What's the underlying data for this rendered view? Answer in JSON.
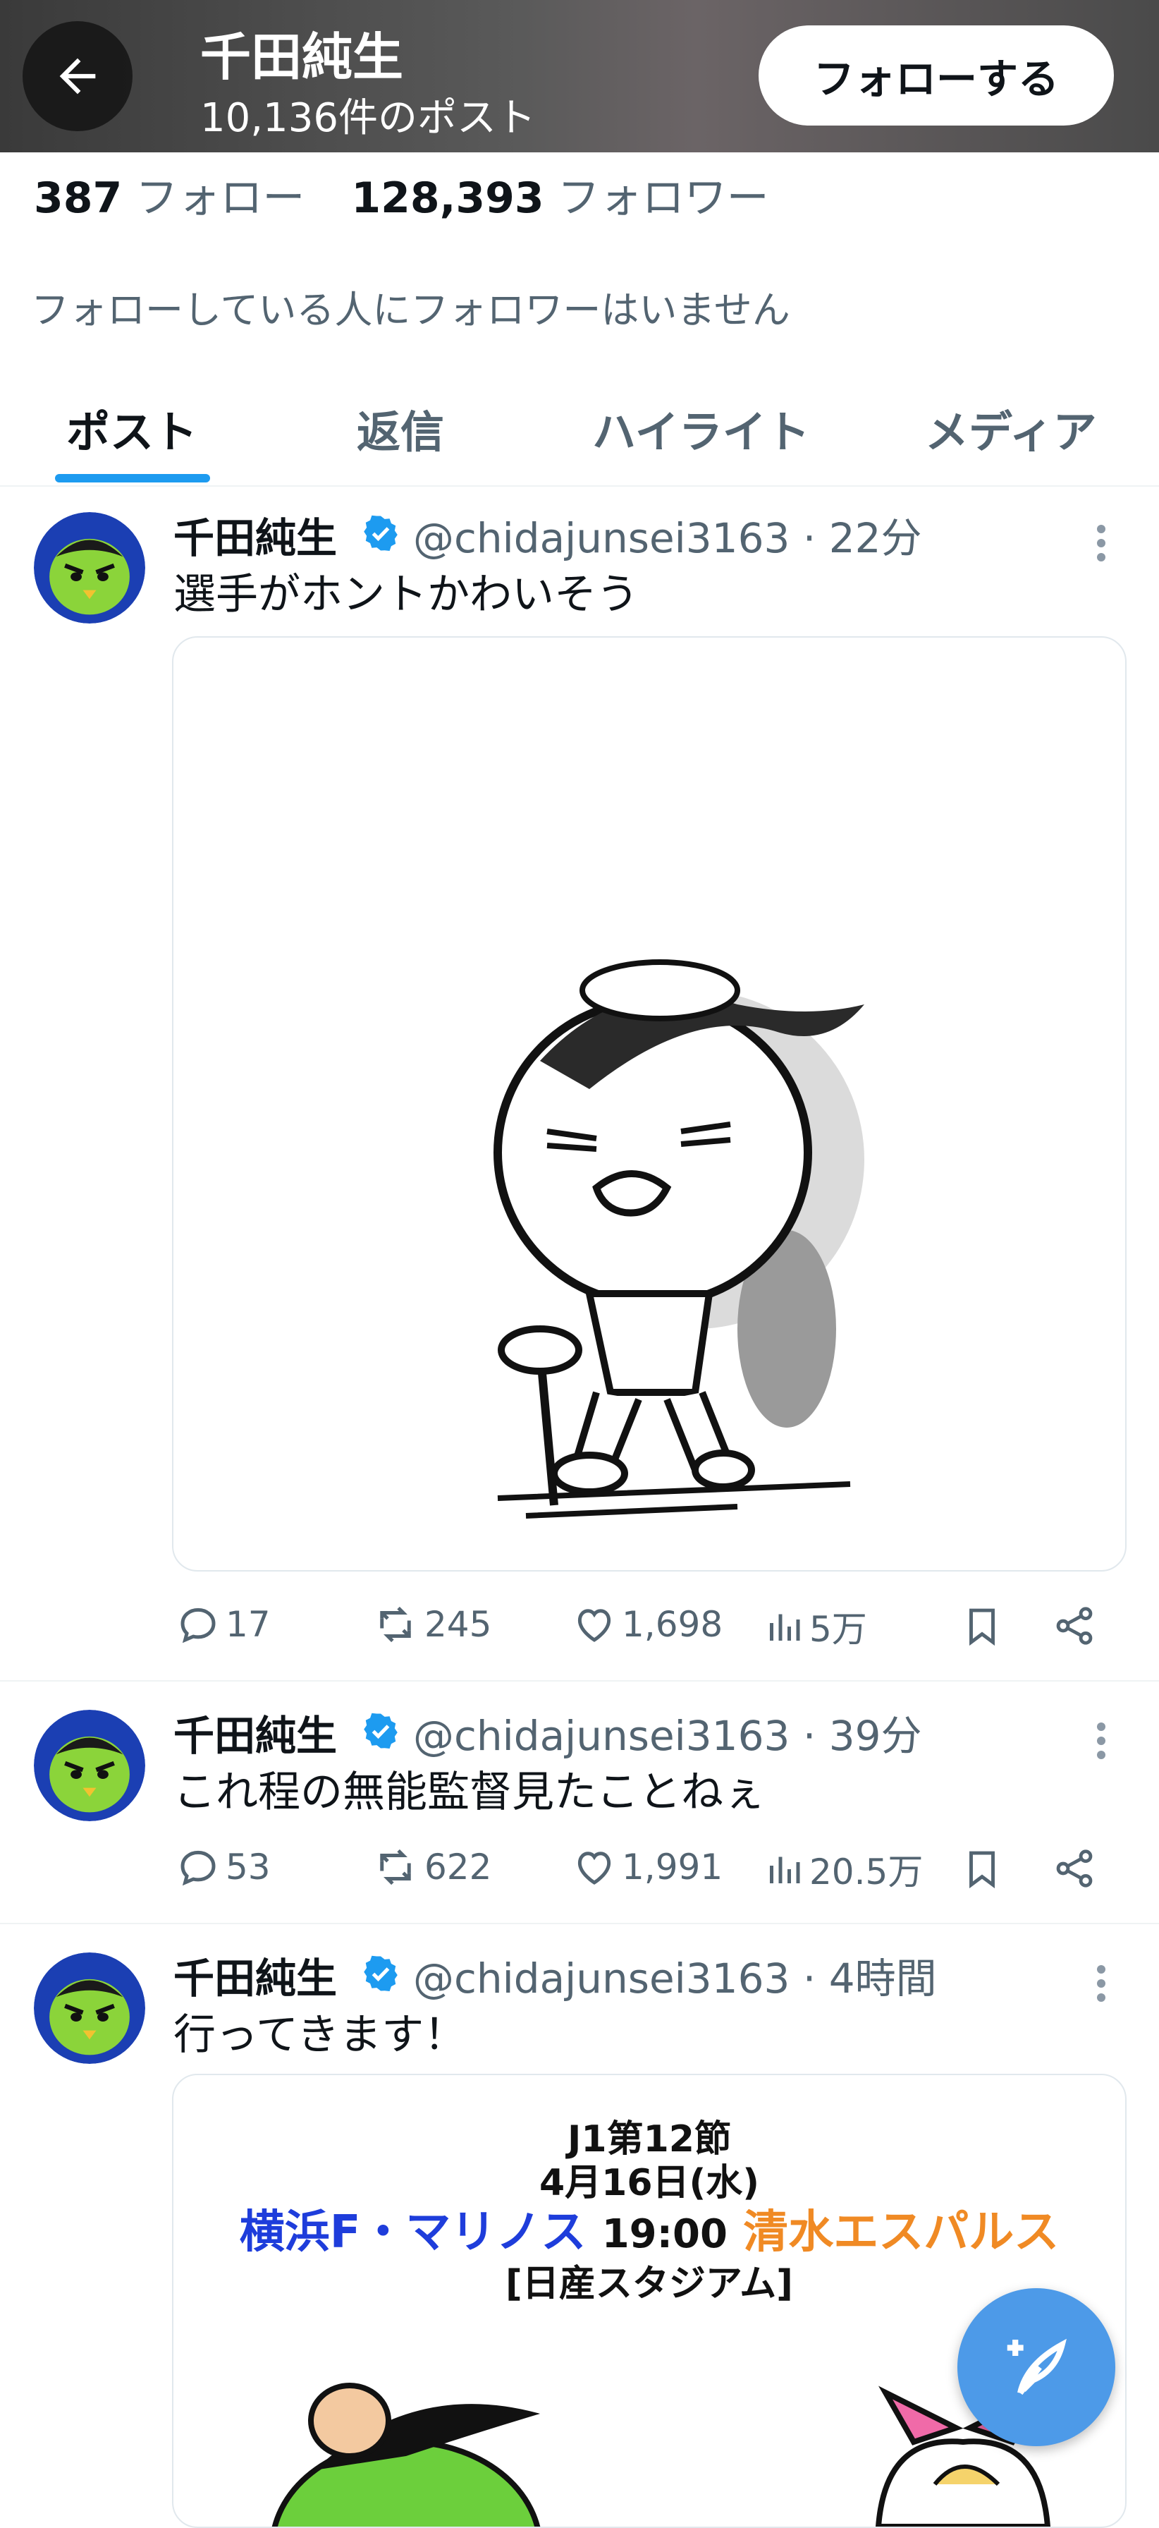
{
  "header": {
    "name": "千田純生",
    "post_count": "10,136件のポスト",
    "follow_button": "フォローする"
  },
  "stats": {
    "following_count": "387",
    "following_label": "フォロー",
    "followers_count": "128,393",
    "followers_label": "フォロワー",
    "no_mutual_note": "フォローしている人にフォロワーはいません"
  },
  "tabs": [
    "ポスト",
    "返信",
    "ハイライト",
    "メディア"
  ],
  "posts": [
    {
      "name": "千田純生",
      "handle": "@chidajunsei3163",
      "time": "· 22分",
      "text": "選手がホントかわいそう",
      "replies": "17",
      "reposts": "245",
      "likes": "1,698",
      "views": "5万"
    },
    {
      "name": "千田純生",
      "handle": "@chidajunsei3163",
      "time": "· 39分",
      "text": "これ程の無能監督見たことねぇ",
      "replies": "53",
      "reposts": "622",
      "likes": "1,991",
      "views": "20.5万"
    },
    {
      "name": "千田純生",
      "handle": "@chidajunsei3163",
      "time": "· 4時間",
      "text": "行ってきます！",
      "poster": {
        "line1": "J1第12節",
        "line2": "4月16日(水)",
        "home": "横浜F・マリノス",
        "kickoff": "19:00",
        "away": "清水エスパルス",
        "venue": "[日産スタジアム]"
      }
    }
  ],
  "icons": [
    "back-arrow-icon",
    "verified-icon",
    "more-icon",
    "reply-icon",
    "repost-icon",
    "like-icon",
    "views-icon",
    "bookmark-icon",
    "share-icon",
    "compose-icon"
  ],
  "colors": {
    "accent": "#1d9bf0",
    "verified": "#1d9bf0",
    "secondary_text": "#536471",
    "home_team": "#1e3ddb",
    "away_team": "#f08a24",
    "fab": "#4d9ae8"
  }
}
